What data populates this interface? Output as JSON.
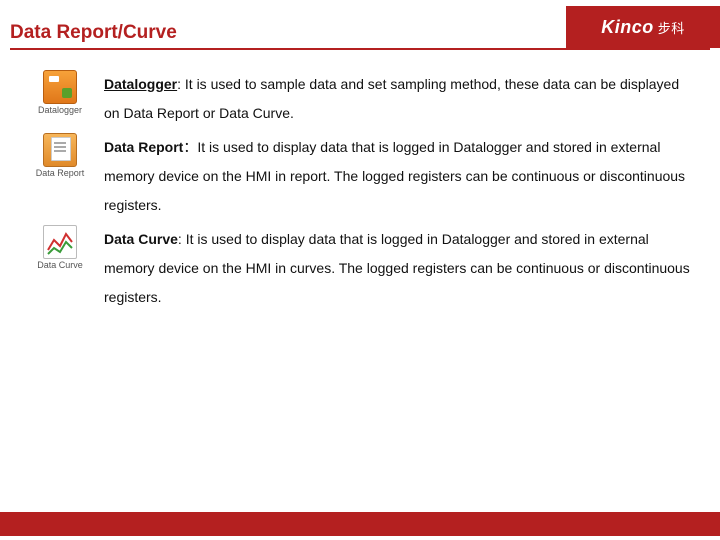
{
  "header": {
    "title": "Data Report/Curve",
    "brand": "Kinco",
    "brand_cn": "步科"
  },
  "items": [
    {
      "icon_label": "Datalogger",
      "title": "Datalogger",
      "desc": ": It is used to sample data and set sampling method, these data can be displayed on Data Report or Data Curve."
    },
    {
      "icon_label": "Data Report",
      "title": "Data Report",
      "desc": "：It is used to display data that is logged in Datalogger and stored in external memory device on the HMI in report. The logged registers can be continuous or discontinuous registers."
    },
    {
      "icon_label": "Data Curve",
      "title": "Data Curve",
      "desc": ": It is used to display data that is logged in Datalogger and stored in external memory device on the HMI in curves. The logged registers can be continuous or discontinuous registers."
    }
  ]
}
